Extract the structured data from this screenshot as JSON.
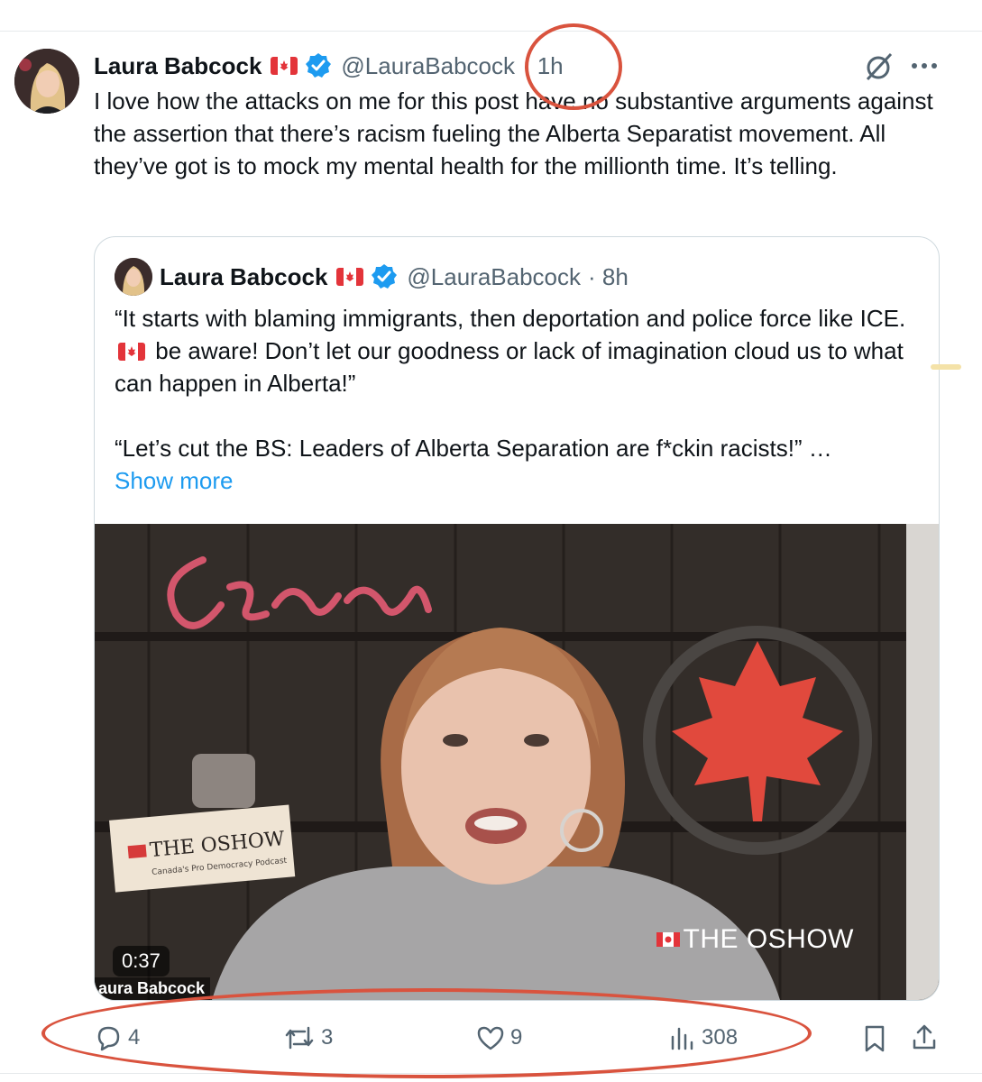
{
  "colors": {
    "accent": "#1d9bf0",
    "text": "#0f1419",
    "muted": "#536471",
    "annotation": "#d9533e",
    "border": "#cfd9de"
  },
  "tweet": {
    "name": "Laura Babcock",
    "handle": "@LauraBabcock",
    "separator": "·",
    "time": "1h",
    "text": "I love how the attacks on me for this post have no substantive arguments against the assertion that there’s racism fueling the Alberta Separatist movement. All they’ve got is to mock my mental health for the millionth time. It’s telling.",
    "more_icon": "more-icon",
    "grok_icon": "grok-icon"
  },
  "quoted": {
    "name": "Laura Babcock",
    "handle": "@LauraBabcock",
    "time_label": "· 8h",
    "text_line1": "“It starts with blaming immigrants, then deportation and police force like ICE.",
    "text_line1_end": "be aware! Don’t let our goodness or lack of imagination cloud us to what can happen in Alberta!”",
    "text_2": "“Let’s cut the BS: Leaders of Alberta Separation are f*ckin racists!” …",
    "show_more": "Show more",
    "video": {
      "duration": "0:37",
      "caption": "aura Babcock",
      "neon_sign": "Oshow",
      "box_label": "THE OSHOW",
      "box_sublabel": "Canada's Pro Democracy Podcast",
      "watermark": "THE OSHOW"
    }
  },
  "actions": {
    "replies": "4",
    "reposts": "3",
    "likes": "9",
    "views": "308"
  }
}
